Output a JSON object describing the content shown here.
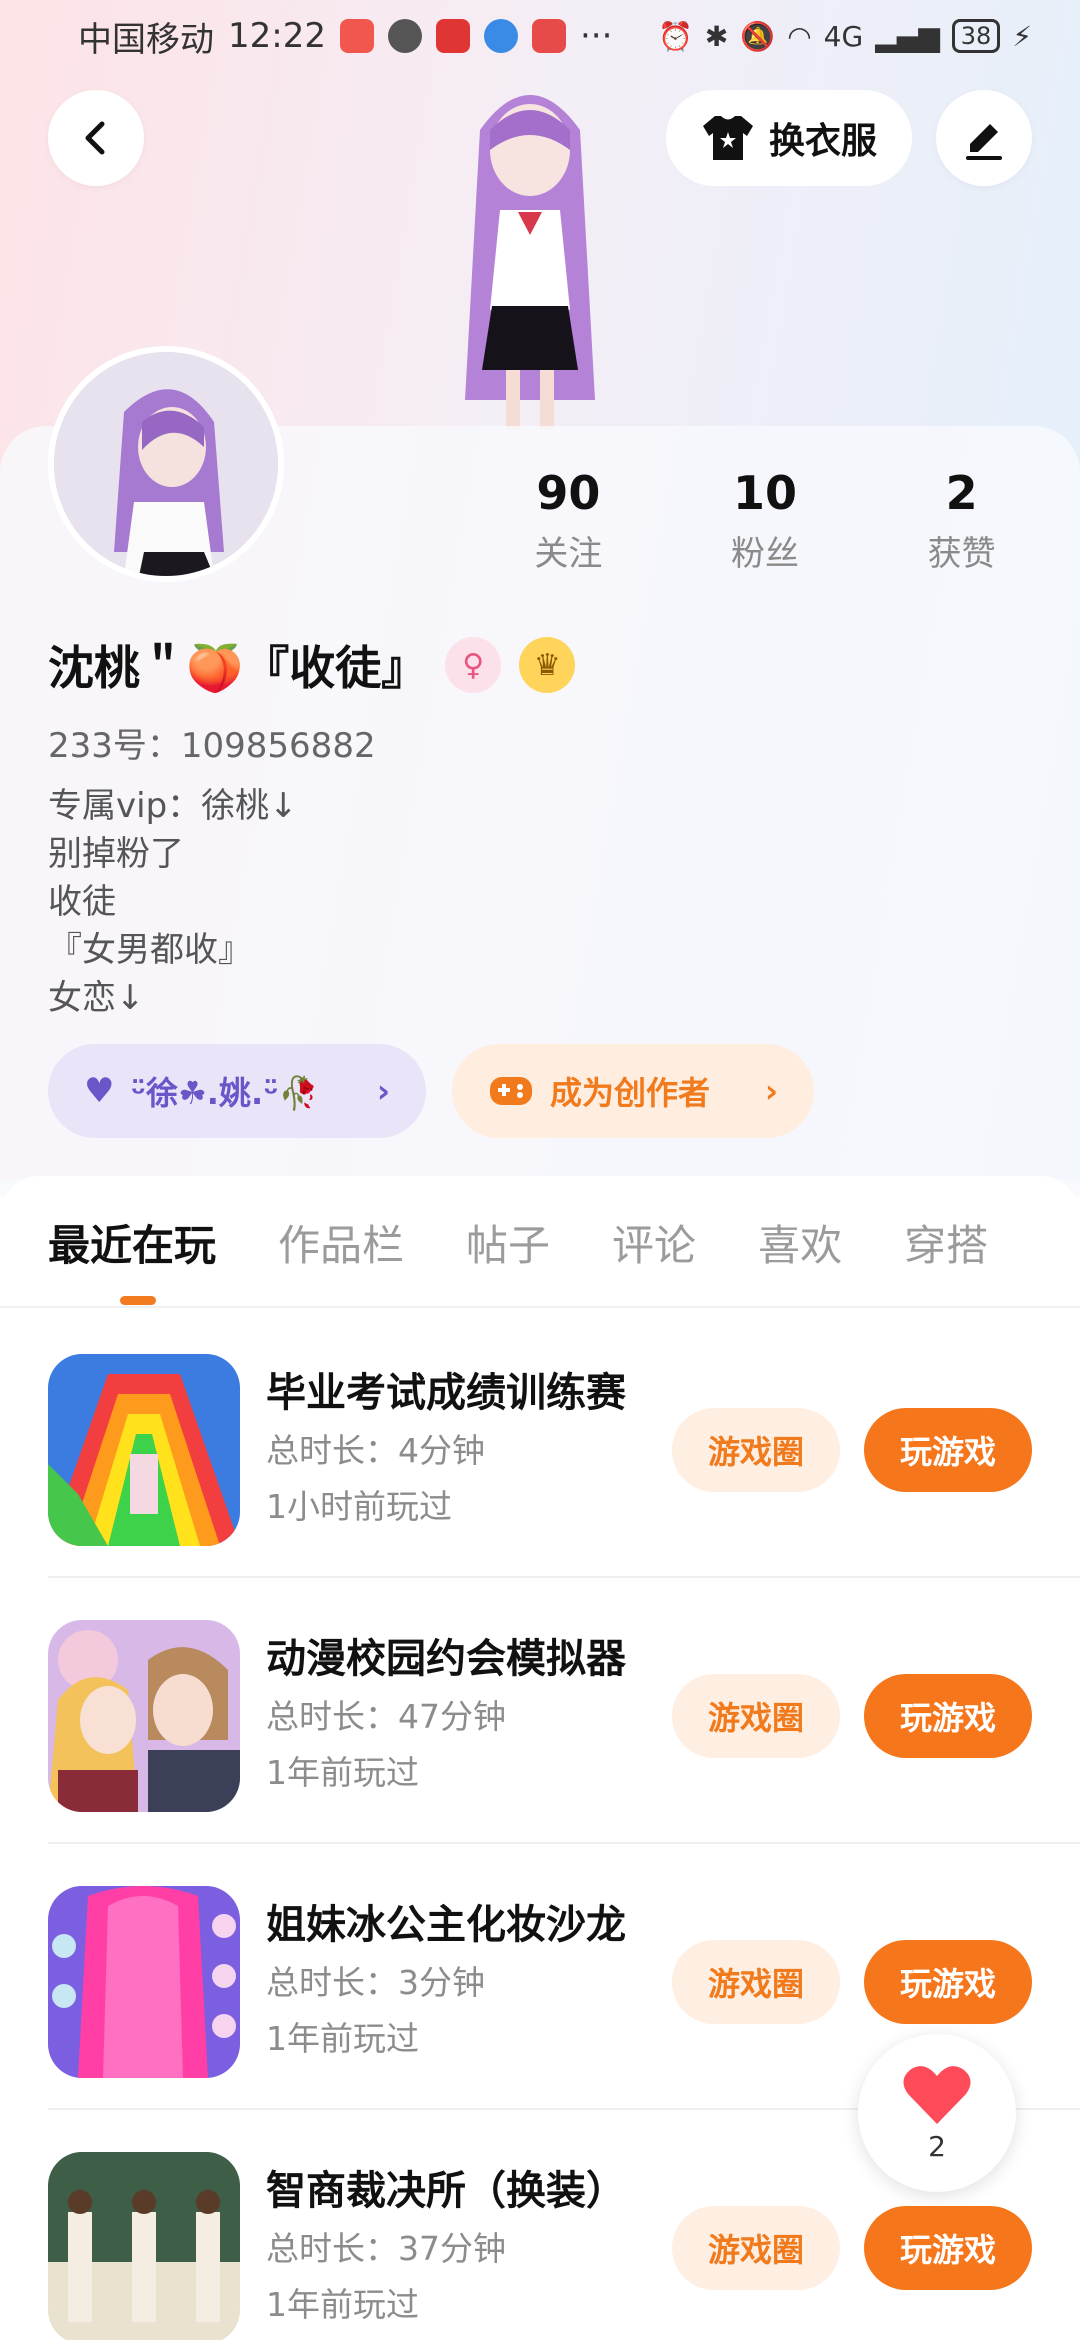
{
  "status_bar": {
    "carrier": "中国移动",
    "time": "12:22",
    "dots": "···",
    "network": "4G",
    "battery": "38"
  },
  "header": {
    "back_icon": "chevron-left-icon",
    "dress_label": "换衣服",
    "edit_icon": "pen-icon"
  },
  "profile": {
    "stats": [
      {
        "value": "90",
        "label": "关注"
      },
      {
        "value": "10",
        "label": "粉丝"
      },
      {
        "value": "2",
        "label": "获赞"
      }
    ],
    "name": "沈桃＂🍑『收徒』",
    "uid": "233号：109856882",
    "bio": [
      "专属vip：徐桃↓",
      "别掉粉了",
      "收徒",
      "『女男都收』",
      "女恋↓"
    ],
    "guard_pill": "ᵕ̈徐☘︎.姚.ᵕ̈🥀",
    "creator_pill": "成为创作者"
  },
  "tabs": [
    "最近在玩",
    "作品栏",
    "帖子",
    "评论",
    "喜欢",
    "穿搭"
  ],
  "active_tab": 0,
  "games": [
    {
      "title": "毕业考试成绩训练赛",
      "duration": "总时长：4分钟",
      "last_played": "1小时前玩过",
      "circle_label": "游戏圈",
      "play_label": "玩游戏"
    },
    {
      "title": "动漫校园约会模拟器",
      "duration": "总时长：47分钟",
      "last_played": "1年前玩过",
      "circle_label": "游戏圈",
      "play_label": "玩游戏"
    },
    {
      "title": "姐妹冰公主化妆沙龙",
      "duration": "总时长：3分钟",
      "last_played": "1年前玩过",
      "circle_label": "游戏圈",
      "play_label": "玩游戏"
    },
    {
      "title": "智商裁决所（换装）",
      "duration": "总时长：37分钟",
      "last_played": "1年前玩过",
      "circle_label": "游戏圈",
      "play_label": "玩游戏"
    }
  ],
  "like_float": {
    "count": "2"
  },
  "colors": {
    "accent": "#f6761b",
    "accent_light": "#ffeee2",
    "guard": "#6a55c9"
  }
}
